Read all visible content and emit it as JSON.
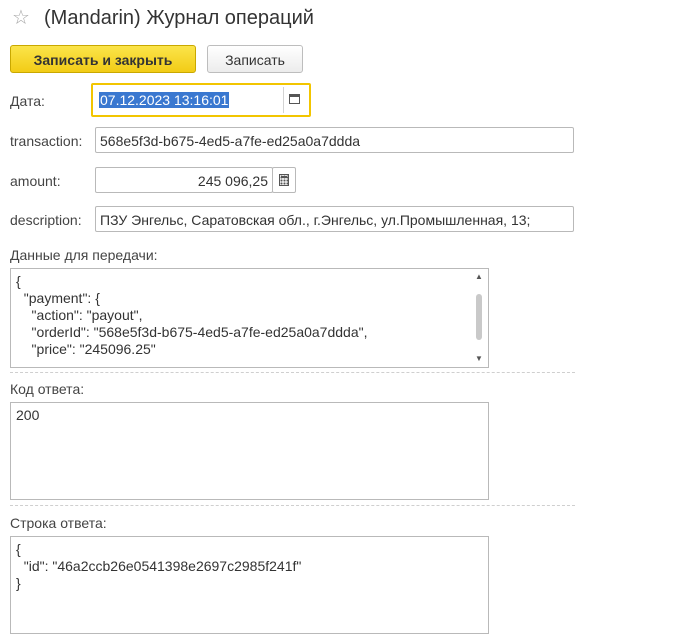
{
  "header": {
    "star_icon": "star-icon",
    "title": "(Mandarin) Журнал операций"
  },
  "toolbar": {
    "save_close_label": "Записать и закрыть",
    "save_label": "Записать"
  },
  "form": {
    "date": {
      "label": "Дата:",
      "value": "07.12.2023 13:16:01",
      "icon": "calendar-icon"
    },
    "transaction": {
      "label": "transaction:",
      "value": "568e5f3d-b675-4ed5-a7fe-ed25a0a7ddda"
    },
    "amount": {
      "label": "amount:",
      "value": "245 096,25",
      "icon": "calculator-icon"
    },
    "description": {
      "label": "description:",
      "value": "ПЗУ Энгельс, Саратовская обл., г.Энгельс, ул.Промышленная, 13;"
    },
    "transfer_data": {
      "label": "Данные для передачи:",
      "value": "{\n  \"payment\": {\n    \"action\": \"payout\",\n    \"orderId\": \"568e5f3d-b675-4ed5-a7fe-ed25a0a7ddda\",\n    \"price\": \"245096.25\""
    },
    "response_code": {
      "label": "Код ответа:",
      "value": "200"
    },
    "response_string": {
      "label": "Строка ответа:",
      "value": "{\n  \"id\": \"46a2ccb26e0541398e2697c2985f241f\"\n}"
    }
  }
}
